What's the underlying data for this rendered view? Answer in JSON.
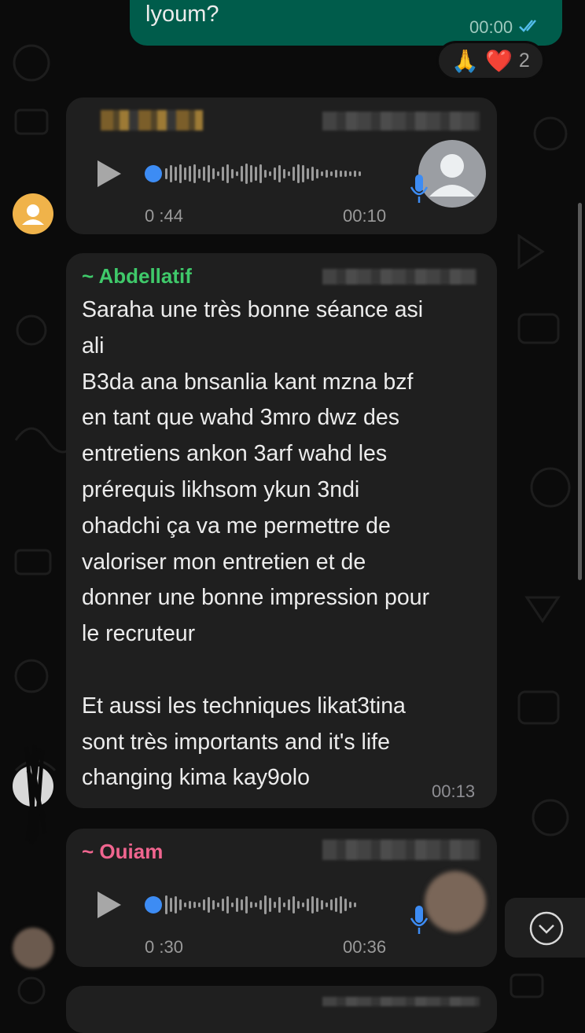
{
  "outgoing": {
    "text": "lyoum?",
    "time": "00:00",
    "reactions": {
      "emojis": [
        "🙏",
        "❤️"
      ],
      "count": "2"
    }
  },
  "voice_message_1": {
    "position": "0 :44",
    "time": "00:10"
  },
  "message_abdellatif": {
    "sender": "~ Abdellatif",
    "sender_color": "#3fc96a",
    "text": "Saraha une très bonne séance asi\nali\nB3da ana bnsanlia kant mzna bzf\nen tant que wahd 3mro dwz des\nentretiens ankon 3arf wahd les\nprérequis likhsom ykun 3ndi\nohadchi ça va me permettre de\nvaloriser mon entretien et de\ndonner une bonne impression pour\nle recruteur\n\nEt aussi les techniques likat3tina\nsont très importants and it's life\nchanging kima kay9olo",
    "time": "00:13"
  },
  "voice_message_2": {
    "sender": "~ Ouiam",
    "sender_color": "#f0658f",
    "position": "0 :30",
    "time": "00:36"
  },
  "colors": {
    "accent_blue": "#3d8cf4",
    "bubble_incoming": "#1f1f1f",
    "bubble_outgoing": "#005c4b"
  }
}
